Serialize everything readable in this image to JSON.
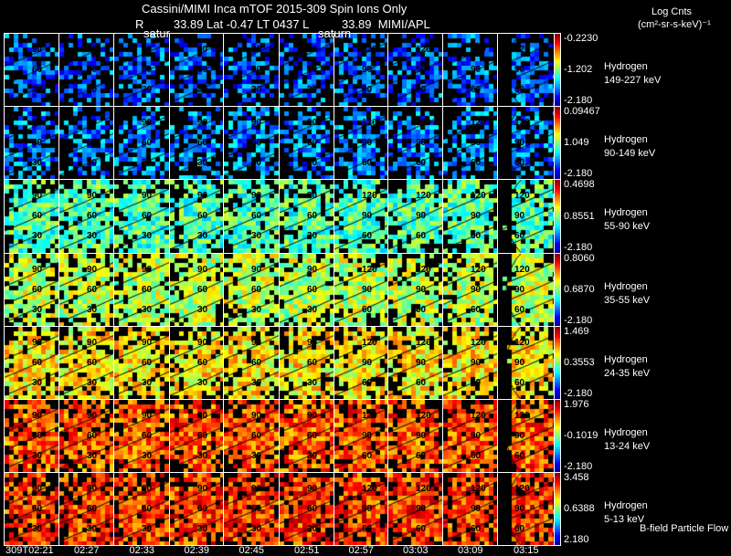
{
  "header": {
    "title": "Cassini/MIMI Inca mTOF  2015-309   Spin   Ions Only",
    "subtitle": "R         33.89 Lat -0.47 LT 0437 L          33.89  MIMI/APL",
    "overlay_left": "satur",
    "overlay_mid": "saturn"
  },
  "colorbar_title": {
    "line1": "Log Cnts",
    "line2": "(cm²-sr-s-keV)⁻¹"
  },
  "footer_note": "B-field Particle Flow",
  "chart_data": {
    "type": "heatmap",
    "title": "Cassini/MIMI Inca mTOF  2015-309   Spin   Ions Only",
    "time_ticks": [
      "309T02:21",
      "02:27",
      "02:33",
      "02:39",
      "02:45",
      "02:51",
      "02:57",
      "03:03",
      "03:09",
      "03:15"
    ],
    "contour_labels": [
      "30",
      "60",
      "90",
      "120"
    ],
    "rows": [
      {
        "species": "Hydrogen",
        "energy": "149-227 keV",
        "cbar_max": "-0.2230",
        "cbar_mid": "-1.202",
        "cbar_min": "-2.180",
        "level": 0.22
      },
      {
        "species": "Hydrogen",
        "energy": "90-149 keV",
        "cbar_max": "0.09467",
        "cbar_mid": "1.049",
        "cbar_min": "-2.180",
        "level": 0.26
      },
      {
        "species": "Hydrogen",
        "energy": "55-90 keV",
        "cbar_max": "0.4698",
        "cbar_mid": "0.8551",
        "cbar_min": "-2.180",
        "level": 0.45
      },
      {
        "species": "Hydrogen",
        "energy": "35-55 keV",
        "cbar_max": "0.8060",
        "cbar_mid": "0.6870",
        "cbar_min": "-2.180",
        "level": 0.56
      },
      {
        "species": "Hydrogen",
        "energy": "24-35 keV",
        "cbar_max": "1.469",
        "cbar_mid": "0.3553",
        "cbar_min": "-2.180",
        "level": 0.64
      },
      {
        "species": "Hydrogen",
        "energy": "13-24 keV",
        "cbar_max": "1.976",
        "cbar_mid": "-0.1019",
        "cbar_min": "-2.180",
        "level": 0.79
      },
      {
        "species": "Hydrogen",
        "energy": "5-13 keV",
        "cbar_max": "3.458",
        "cbar_mid": "0.6388",
        "cbar_min": "2.180",
        "level": 0.82
      }
    ]
  }
}
